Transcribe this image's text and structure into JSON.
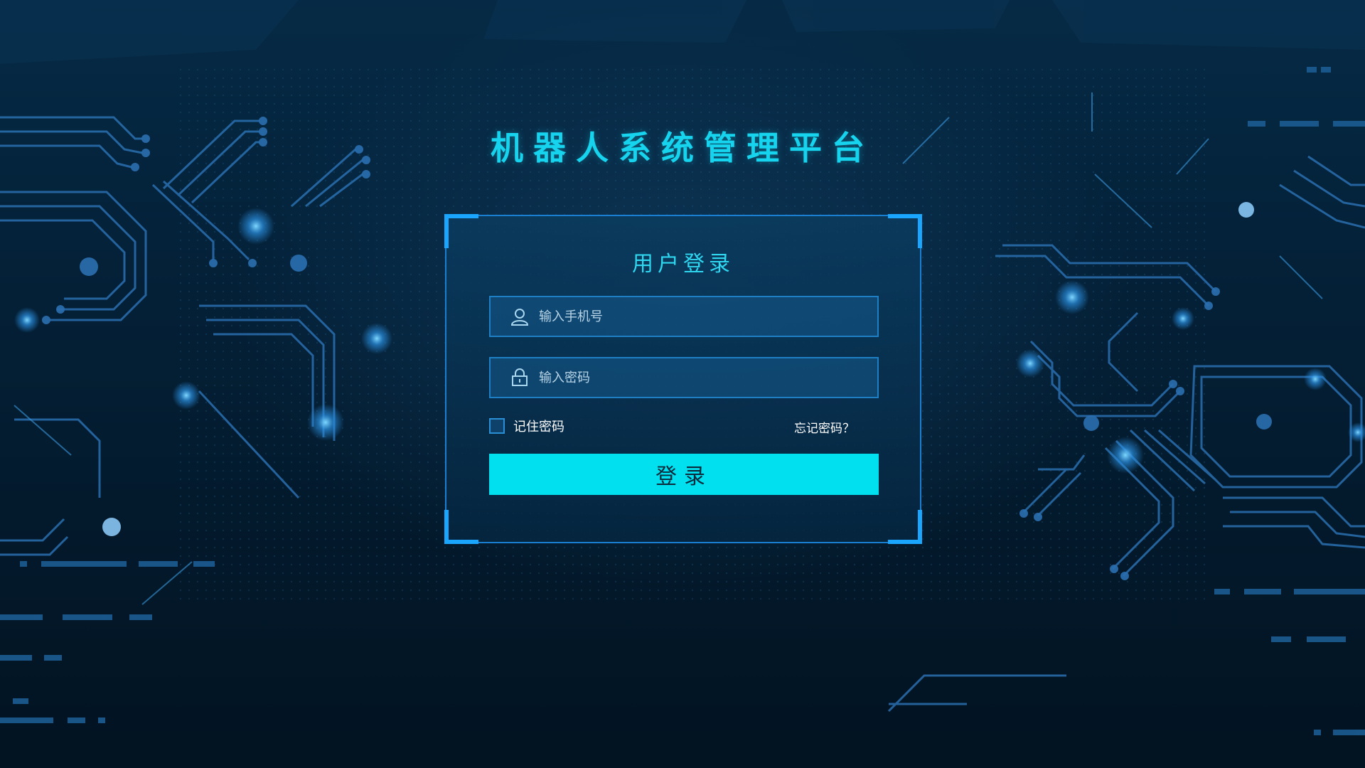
{
  "app": {
    "title": "机器人系统管理平台"
  },
  "login": {
    "heading": "用户登录",
    "phone_placeholder": "输入手机号",
    "phone_value": "",
    "password_placeholder": "输入密码",
    "password_value": "",
    "remember_label": "记住密码",
    "remember_checked": false,
    "forgot_label": "忘记密码？",
    "submit_label": "登录"
  },
  "icons": {
    "phone_field_icon": "user-icon",
    "password_field_icon": "lock-icon"
  },
  "colors": {
    "accent": "#00e0ee",
    "title": "#17d4ee",
    "panel_border": "#1a7fd1",
    "background": "#041a2c"
  }
}
